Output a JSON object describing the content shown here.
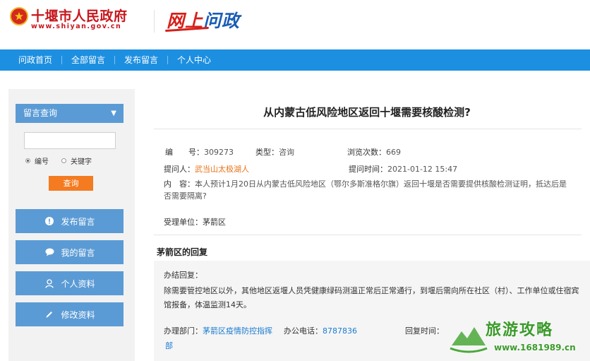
{
  "header": {
    "site_name": "十堰市人民政府",
    "site_url": "www.shiyan.gov.cn",
    "brand_part1": "网上",
    "brand_part2": "问政"
  },
  "nav": {
    "items": [
      {
        "label": "问政首页"
      },
      {
        "label": "全部留言"
      },
      {
        "label": "发布留言"
      },
      {
        "label": "个人中心"
      }
    ]
  },
  "sidebar": {
    "search_header": "留言查询",
    "search_placeholder": "",
    "radio_number": "编号",
    "radio_keyword": "关键字",
    "query_button": "查询",
    "buttons": [
      {
        "label": "发布留言",
        "icon": "alert-icon"
      },
      {
        "label": "我的留言",
        "icon": "chat-icon"
      },
      {
        "label": "个人资料",
        "icon": "user-icon"
      },
      {
        "label": "修改资料",
        "icon": "pencil-icon"
      }
    ]
  },
  "post": {
    "title": "从内蒙古低风险地区返回十堰需要核酸检测?",
    "number_label": "编　　号：",
    "number": "309273",
    "type_label": "类型：",
    "type": "咨询",
    "views_label": "浏览次数：",
    "views": "669",
    "asker_label": "提问人：",
    "asker": "武当山太极湖人",
    "time_label": "提问时间：",
    "time": "2021-01-12 15:47",
    "content_label": "内　容：",
    "content": "本人预计1月20日从内蒙古低风险地区（鄂尔多斯准格尔旗）返回十堰是否需要提供核酸检测证明，抵达后是否需要隔离?",
    "unit_label": "受理单位：",
    "unit": "茅箭区"
  },
  "reply": {
    "heading": "茅箭区的回复",
    "label": "办结回复：",
    "body": "除需要管控地区以外，其他地区返堰人员凭健康绿码测温正常后正常通行，到堰后需向所在社区（村）、工作单位或住宿宾馆报备，体温监测14天。",
    "dept_label": "办理部门：",
    "dept_part1": "茅箭区疫情防控指挥",
    "dept_part2": "部",
    "phone_label": "办公电话：",
    "phone": "8787836",
    "reply_time_label": "回复时间："
  },
  "watermark": {
    "title": "旅游攻略",
    "url": "www.1681989.cn"
  },
  "colors": {
    "nav_blue": "#1d8fe1",
    "sidebar_blue": "#5b9bd5",
    "accent_orange": "#f47b20",
    "gov_red": "#c8161d"
  }
}
